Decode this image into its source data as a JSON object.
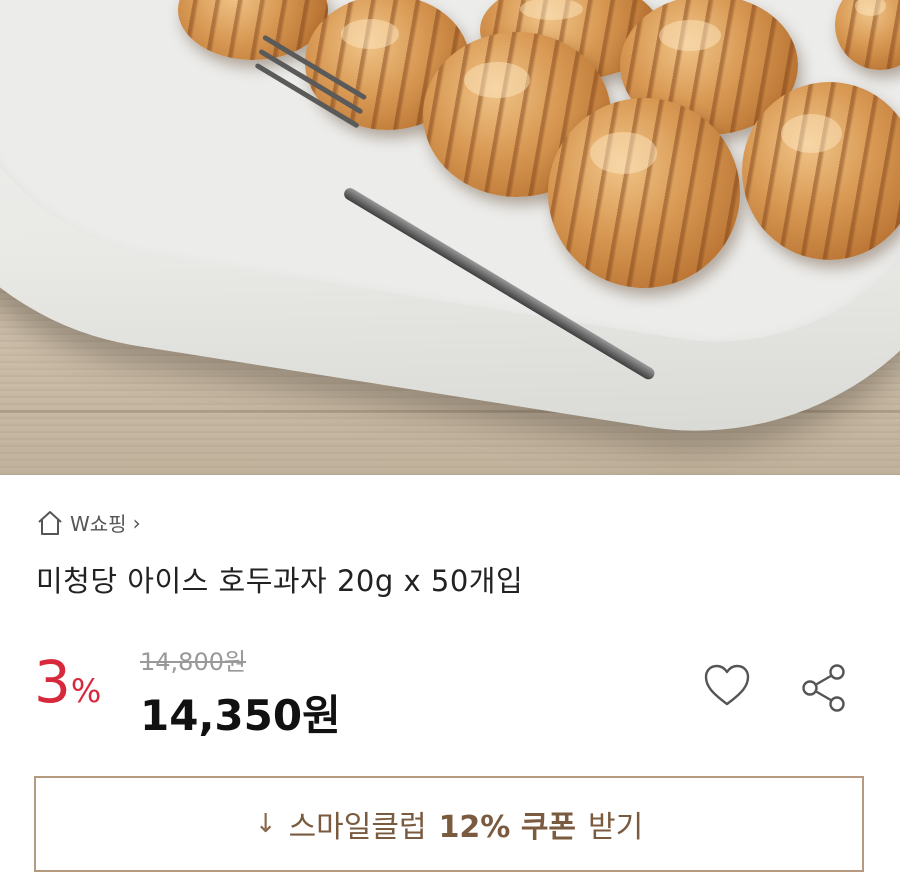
{
  "product_image": {
    "alt": "",
    "icon": "walnut-cake-photo"
  },
  "shop": {
    "name": "W쇼핑",
    "chevron": "›",
    "icon": "home-icon"
  },
  "product": {
    "title": "미청당  아이스 호두과자 20g x 50개입"
  },
  "pricing": {
    "discount_number": "3",
    "discount_symbol": "%",
    "original_price": "14,800원",
    "sale_price": "14,350원",
    "accent_color": "#d7283c"
  },
  "actions": {
    "heart_icon": "heart-icon",
    "share_icon": "share-icon"
  },
  "coupon": {
    "arrow": "↓",
    "text_prefix": "스마일클럽",
    "text_bold": "12% 쿠폰",
    "text_suffix": "받기",
    "border_color": "#b59a80"
  }
}
